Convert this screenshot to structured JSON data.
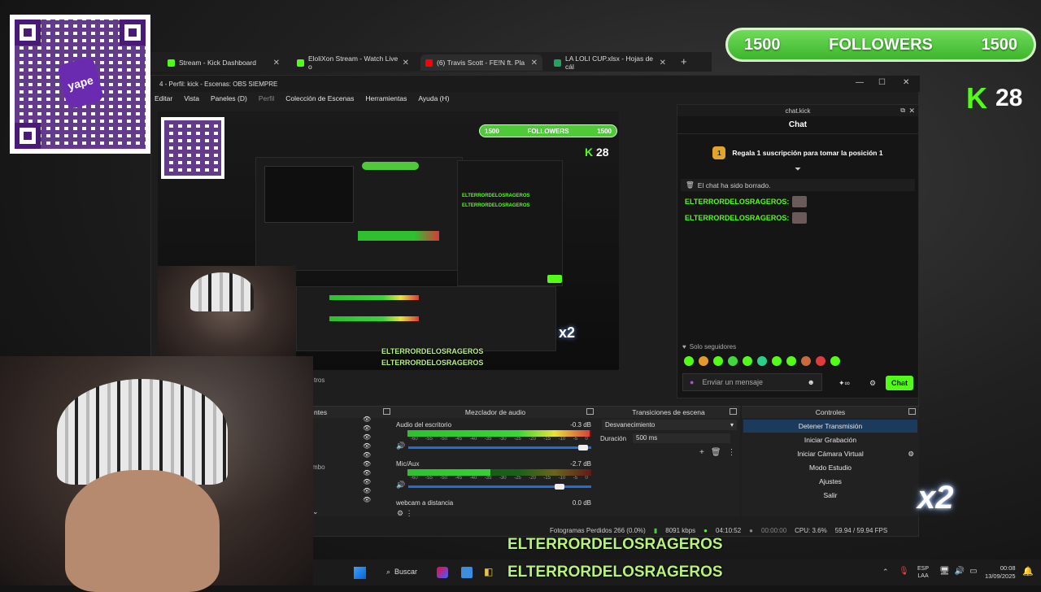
{
  "browser": {
    "tabs": [
      {
        "label": "Stream - Kick Dashboard",
        "color": "#53fc18"
      },
      {
        "label": "EloliXon Stream - Watch Live o",
        "color": "#53fc18"
      },
      {
        "label": "(6) Travis Scott - FE!N ft. Pla",
        "color": "#ff0000"
      },
      {
        "label": "LA LOLI CUP.xlsx - Hojas de cál",
        "color": "#1fa463"
      }
    ],
    "new_tab": "+"
  },
  "obs": {
    "title": "4 - Perfil: kick - Escenas: OBS SIEMPRE",
    "menu": [
      "Editar",
      "Vista",
      "Paneles (D)",
      "Perfil",
      "Colección de Escenas",
      "Herramientas",
      "Ayuda (H)"
    ],
    "sources_fragment": "ntes",
    "tros_fragment": "tros",
    "mbo_fragment": "mbo"
  },
  "mixer": {
    "title": "Mezclador de audio",
    "channels": [
      {
        "name": "Audio del escritorio",
        "db": "-0.3 dB",
        "level": 0.99,
        "volume": 0.93
      },
      {
        "name": "Mic/Aux",
        "db": "-2.7 dB",
        "level": 0.45,
        "volume": 0.8
      },
      {
        "name": "webcam a distancia",
        "db": "0.0 dB"
      }
    ],
    "ticks": [
      "-60",
      "-55",
      "-50",
      "-45",
      "-40",
      "-35",
      "-30",
      "-25",
      "-20",
      "-15",
      "-10",
      "-5",
      "0"
    ]
  },
  "transitions": {
    "title": "Transiciones de escena",
    "selected": "Desvanecimiento",
    "duration_label": "Duración",
    "duration_value": "500 ms"
  },
  "controls": {
    "title": "Controles",
    "buttons": [
      "Detener Transmisión",
      "Iniciar Grabación",
      "Iniciar Cámara Virtual",
      "Modo Estudio",
      "Ajustes",
      "Salir"
    ]
  },
  "status": {
    "dropped": "Fotogramas Perdidos 266 (0.0%)",
    "bitrate": "8091 kbps",
    "live_time": "04:10:52",
    "rec_time": "00:00:00",
    "cpu": "CPU: 3.6%",
    "fps": "59.94 / 59.94 FPS"
  },
  "chat": {
    "window_title": "chat.kick",
    "title": "Chat",
    "pinned_rank": "1",
    "pinned_text": "Regala 1 suscripción para tomar la posición 1",
    "cleared": "El chat ha sido borrado.",
    "messages": [
      {
        "user": "ELTERRORDELOSRAGEROS:"
      },
      {
        "user": "ELTERRORDELOSRAGEROS:"
      }
    ],
    "followers_only": "Solo seguidores",
    "input_placeholder": "Enviar un mensaje",
    "send": "Chat"
  },
  "overlay": {
    "followers_left": "1500",
    "followers_label": "FOLLOWERS",
    "followers_right": "1500",
    "kick_count": "28",
    "multiplier": "x2",
    "qr_brand": "yape",
    "bottom_user_1": "ELTERRORDELOSRAGEROS",
    "bottom_user_2": "ELTERRORDELOSRAGEROS"
  },
  "taskbar": {
    "search": "Buscar",
    "lang_top": "ESP",
    "lang_bottom": "LAA",
    "time": "00:08",
    "date": "13/09/2025"
  },
  "colors": {
    "kick_green": "#53fc18",
    "obs_blue": "#1f6fd6"
  }
}
